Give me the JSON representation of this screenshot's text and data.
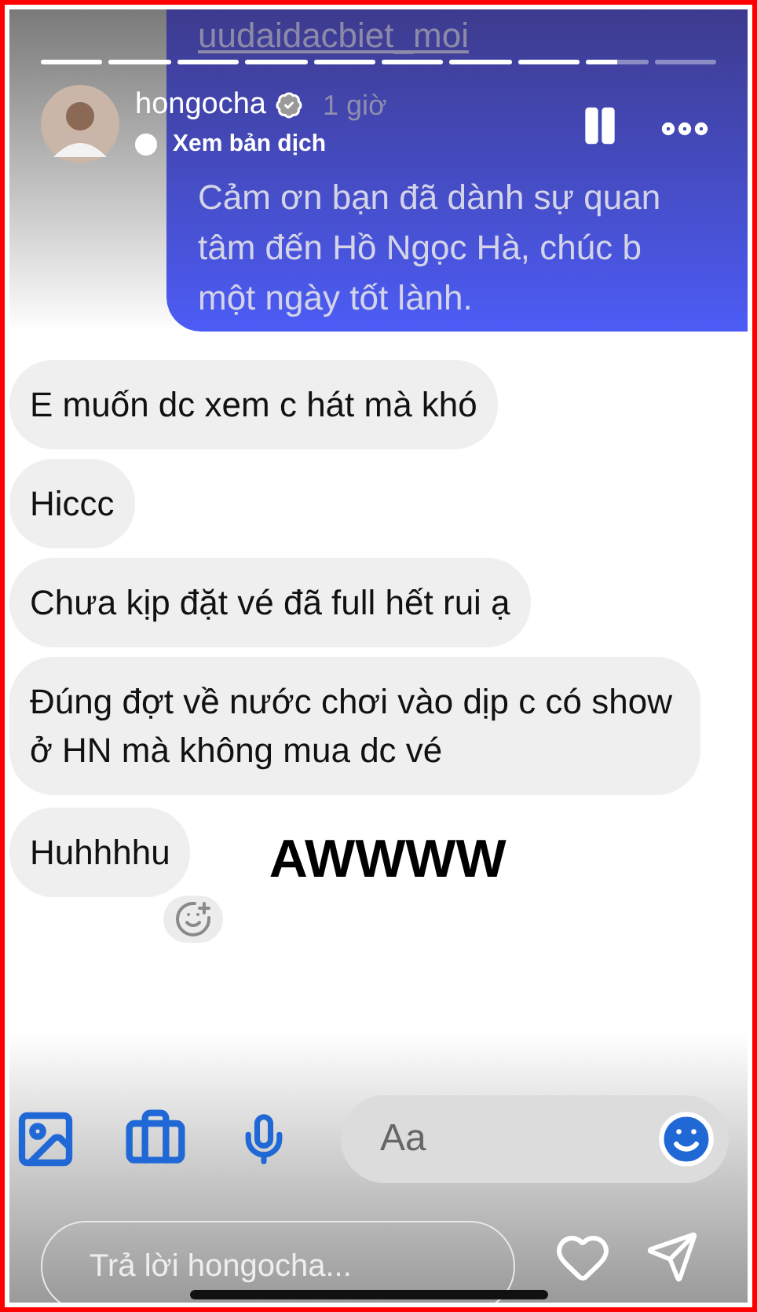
{
  "story": {
    "progress": [
      {
        "kind": "seen"
      },
      {
        "kind": "seen"
      },
      {
        "kind": "seen"
      },
      {
        "kind": "seen"
      },
      {
        "kind": "seen"
      },
      {
        "kind": "seen"
      },
      {
        "kind": "seen"
      },
      {
        "kind": "seen"
      },
      {
        "kind": "playing"
      },
      {
        "kind": "unseen"
      }
    ],
    "username": "hongocha",
    "verified": true,
    "time": "1 giờ",
    "translate": "Xem bản dịch"
  },
  "shared_message": {
    "link": "uudaidacbiet_moi",
    "lines": [
      "Cảm ơn bạn đã dành sự quan",
      "tâm đến Hồ Ngọc Hà, chúc b",
      "một ngày tốt lành."
    ]
  },
  "messages": [
    {
      "text": "E muốn dc xem c hát mà khó"
    },
    {
      "text": "Hiccc"
    },
    {
      "text": "Chưa kịp đặt vé đã full hết rui ạ"
    },
    {
      "text": "Đúng đợt về nước chơi vào dịp c có show ở HN mà không mua dc vé"
    },
    {
      "text": "Huhhhhu"
    }
  ],
  "sticker_text": "AWWWW",
  "composer": {
    "placeholder": "Aa"
  },
  "reply": {
    "placeholder": "Trả lời hongocha..."
  }
}
